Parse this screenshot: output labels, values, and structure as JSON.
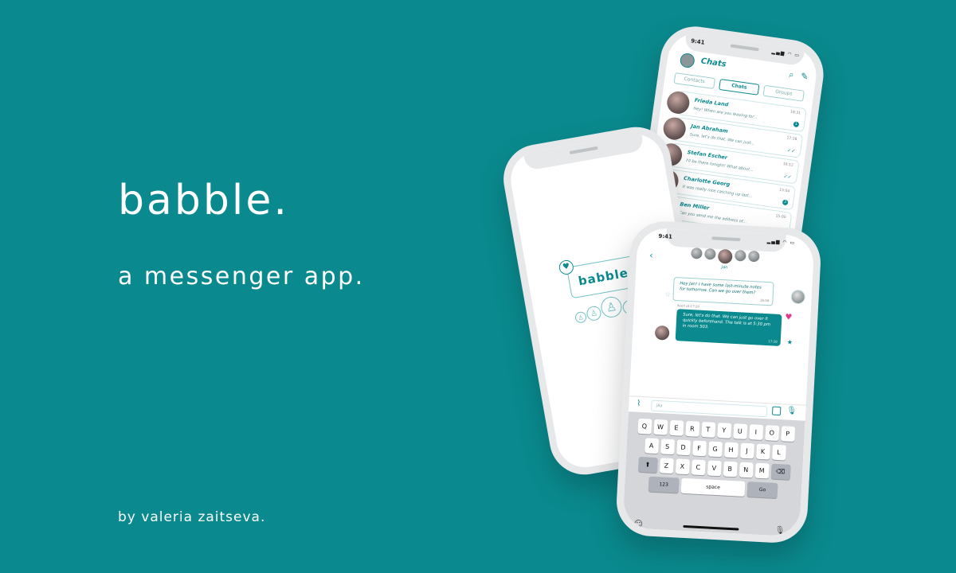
{
  "hero": {
    "title": "babble.",
    "subtitle": "a messenger app.",
    "author": "by valeria zaitseva."
  },
  "status": {
    "time": "9:41",
    "icons": "▂▄▆ ◠ ▭"
  },
  "chats_screen": {
    "title": "Chats",
    "tabs": [
      {
        "label": "Contacts",
        "active": false
      },
      {
        "label": "Chats",
        "active": true
      },
      {
        "label": "Groups",
        "active": false
      }
    ],
    "items": [
      {
        "name": "Frieda Land",
        "preview": "Hey! When are you leaving for...",
        "time": "18:31",
        "badge": "1"
      },
      {
        "name": "Jan Abraham",
        "preview": "Sure, let's do that. We can just...",
        "time": "17:28",
        "badge": ""
      },
      {
        "name": "Stefan Escher",
        "preview": "I'll be there tonight! What about...",
        "time": "16:12",
        "badge": ""
      },
      {
        "name": "Charlotte Georg",
        "preview": "It was really nice catching up last...",
        "time": "15:04",
        "badge": "2"
      },
      {
        "name": "Ben Miller",
        "preview": "Can you send me the address of...",
        "time": "15:00",
        "badge": ""
      }
    ]
  },
  "splash": {
    "logo_text": "babble."
  },
  "conversation": {
    "contact_name": "Jan",
    "incoming": {
      "text": "Hey Jan! I have some last-minute notes for tomorrow. Can we go over them?",
      "time": "16:56"
    },
    "seen": "Seen at 17:20",
    "outgoing": {
      "text": "Sure, let's do that. We can just go over it quickly beforehand. The talk is at 5:30 pm in room 503.",
      "time": "17:28"
    },
    "input_placeholder": "|Aa",
    "keyboard": {
      "row1": [
        "Q",
        "W",
        "E",
        "R",
        "T",
        "Y",
        "U",
        "I",
        "O",
        "P"
      ],
      "row2": [
        "A",
        "S",
        "D",
        "F",
        "G",
        "H",
        "J",
        "K",
        "L"
      ],
      "row3": [
        "Z",
        "X",
        "C",
        "V",
        "B",
        "N",
        "M"
      ],
      "shift": "⬆",
      "delete": "⌫",
      "numbers": "123",
      "space": "space",
      "go": "Go"
    }
  }
}
